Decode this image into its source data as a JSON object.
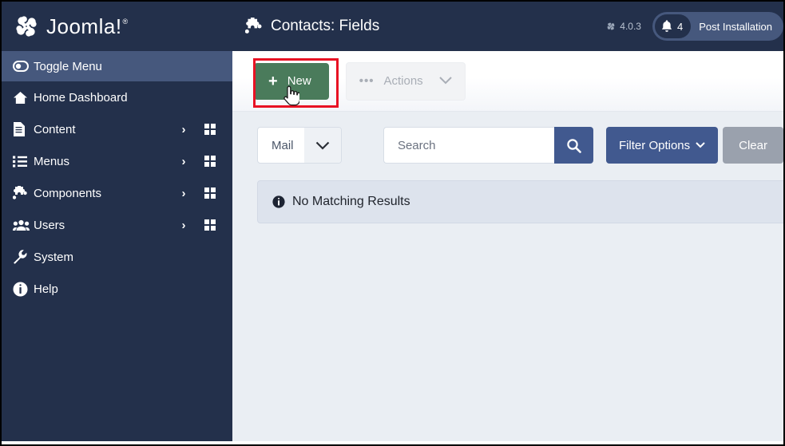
{
  "sidebar": {
    "brand": {
      "name": "Joomla!",
      "registered": "®",
      "icon": "joomla-logo-icon"
    },
    "items": [
      {
        "label": "Toggle Menu",
        "icon": "toggle-icon",
        "active": true,
        "chevron": "",
        "grid": false
      },
      {
        "label": "Home Dashboard",
        "icon": "home-icon",
        "chevron": "",
        "grid": false
      },
      {
        "label": "Content",
        "icon": "document-icon",
        "chevron": "›",
        "grid": true
      },
      {
        "label": "Menus",
        "icon": "list-icon",
        "chevron": "›",
        "grid": true
      },
      {
        "label": "Components",
        "icon": "puzzle-icon",
        "chevron": "›",
        "grid": true
      },
      {
        "label": "Users",
        "icon": "users-icon",
        "chevron": "›",
        "grid": true
      },
      {
        "label": "System",
        "icon": "wrench-icon",
        "chevron": "",
        "grid": false
      },
      {
        "label": "Help",
        "icon": "info-circle-icon",
        "chevron": "",
        "grid": false
      }
    ]
  },
  "header": {
    "title": "Contacts: Fields",
    "title_icon": "puzzle-icon",
    "version": "4.0.3",
    "version_icon": "joomla-mark-icon",
    "notifications": {
      "icon": "bell-icon",
      "count": "4",
      "label": "Post Installation"
    }
  },
  "toolbar": {
    "new_label": "New",
    "new_plus": "+",
    "actions_label": "Actions",
    "actions_dots": "•••",
    "actions_caret": "⌄",
    "highlight_color": "#e81123",
    "new_button_color": "#4a7b5b"
  },
  "filters": {
    "select_value": "Mail",
    "select_caret": "⌄",
    "search_placeholder": "Search",
    "search_value": "",
    "search_icon": "magnifier-icon",
    "filter_options_label": "Filter Options",
    "filter_options_caret": "⌄",
    "clear_label": "Clear",
    "accent_color": "#41598f",
    "clear_color": "#9aa1ad"
  },
  "content": {
    "alert_icon": "info-circle-icon",
    "alert_text": "No Matching Results"
  }
}
